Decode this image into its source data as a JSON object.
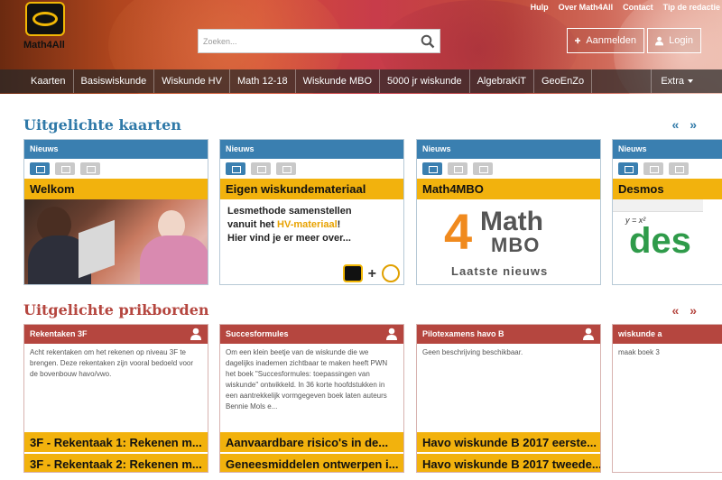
{
  "header": {
    "logo_text": "Math4All",
    "toplinks": [
      "Hulp",
      "Over Math4All",
      "Contact",
      "Tip de redactie"
    ],
    "search_placeholder": "Zoeken...",
    "register_label": "Aanmelden",
    "login_label": "Login"
  },
  "nav": {
    "items": [
      "Kaarten",
      "Basiswiskunde",
      "Wiskunde HV",
      "Math 12-18",
      "Wiskunde MBO",
      "5000 jr wiskunde",
      "AlgebraKiT",
      "GeoEnZo"
    ],
    "extra": "Extra"
  },
  "featured_cards": {
    "title": "Uitgelichte kaarten",
    "nav_arrows": "« »",
    "cards": [
      {
        "category": "Nieuws",
        "title": "Welkom"
      },
      {
        "category": "Nieuws",
        "title": "Eigen wiskundemateriaal",
        "media_line1": "Lesmethode samenstellen",
        "media_line2a": "vanuit het ",
        "media_highlight": "HV-materiaal",
        "media_line2b": "!",
        "media_line3": "Hier vind je er meer over...",
        "media_logo_label": "Math4All",
        "media_plus": "+"
      },
      {
        "category": "Nieuws",
        "title": "Math4MBO",
        "media_four": "4",
        "media_math": "Math",
        "media_mbo": "MBO",
        "media_news": "Laatste nieuws"
      },
      {
        "category": "Nieuws",
        "title": "Desmos",
        "media_formula": "y = x²",
        "media_word": "des"
      }
    ]
  },
  "featured_boards": {
    "title": "Uitgelichte prikborden",
    "nav_arrows": "« »",
    "boards": [
      {
        "name": "Rekentaken 3F",
        "description": "Acht rekentaken om het rekenen op niveau 3F te brengen. Deze rekentaken zijn vooral bedoeld voor de bovenbouw havo/vwo.",
        "items": [
          "3F - Rekentaak 1: Rekenen m...",
          "3F - Rekentaak 2: Rekenen m..."
        ]
      },
      {
        "name": "Succesformules",
        "description": "Om een klein beetje van de wiskunde die we dagelijks inademen zichtbaar te maken heeft PWN het boek \"Succesformules: toepassingen van wiskunde\" ontwikkeld. In 36 korte hoofdstukken in een aantrekkelijk vormgegeven boek laten auteurs Bennie Mols e...",
        "items": [
          "Aanvaardbare risico's in de...",
          "Geneesmiddelen ontwerpen i..."
        ]
      },
      {
        "name": "Pilotexamens havo B",
        "description": "Geen beschrijving beschikbaar.",
        "items": [
          "Havo wiskunde B 2017 eerste...",
          "Havo wiskunde B 2017 tweede..."
        ]
      },
      {
        "name": "wiskunde a",
        "description": "maak boek 3",
        "items": [
          "",
          ""
        ]
      }
    ]
  },
  "colors": {
    "accent_blue": "#3a7fb0",
    "accent_red": "#b5463f",
    "card_title_yellow": "#f2b20d"
  }
}
